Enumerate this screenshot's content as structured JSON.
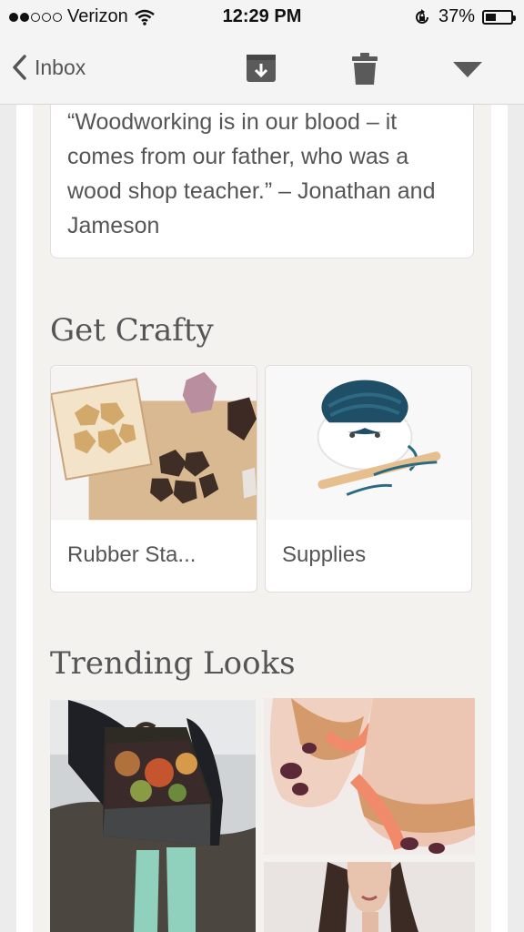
{
  "status_bar": {
    "carrier": "Verizon",
    "time": "12:29 PM",
    "battery": "37%"
  },
  "nav": {
    "back_label": "Inbox"
  },
  "quote": {
    "text": "“Woodworking is in our blood – it comes from our father, who was a wood shop teacher.” – Jonathan and Jameson"
  },
  "sections": {
    "crafty_title": "Get Crafty",
    "trending_title": "Trending Looks"
  },
  "crafty_tiles": [
    {
      "label": "Rubber Sta..."
    },
    {
      "label": "Supplies"
    }
  ],
  "icons": {
    "signal": "signal-dots-icon",
    "wifi": "wifi-icon",
    "rotation_lock": "rotation-lock-icon",
    "battery": "battery-icon",
    "back": "chevron-left-icon",
    "archive": "archive-icon",
    "trash": "trash-icon",
    "more": "triangle-down-icon"
  }
}
